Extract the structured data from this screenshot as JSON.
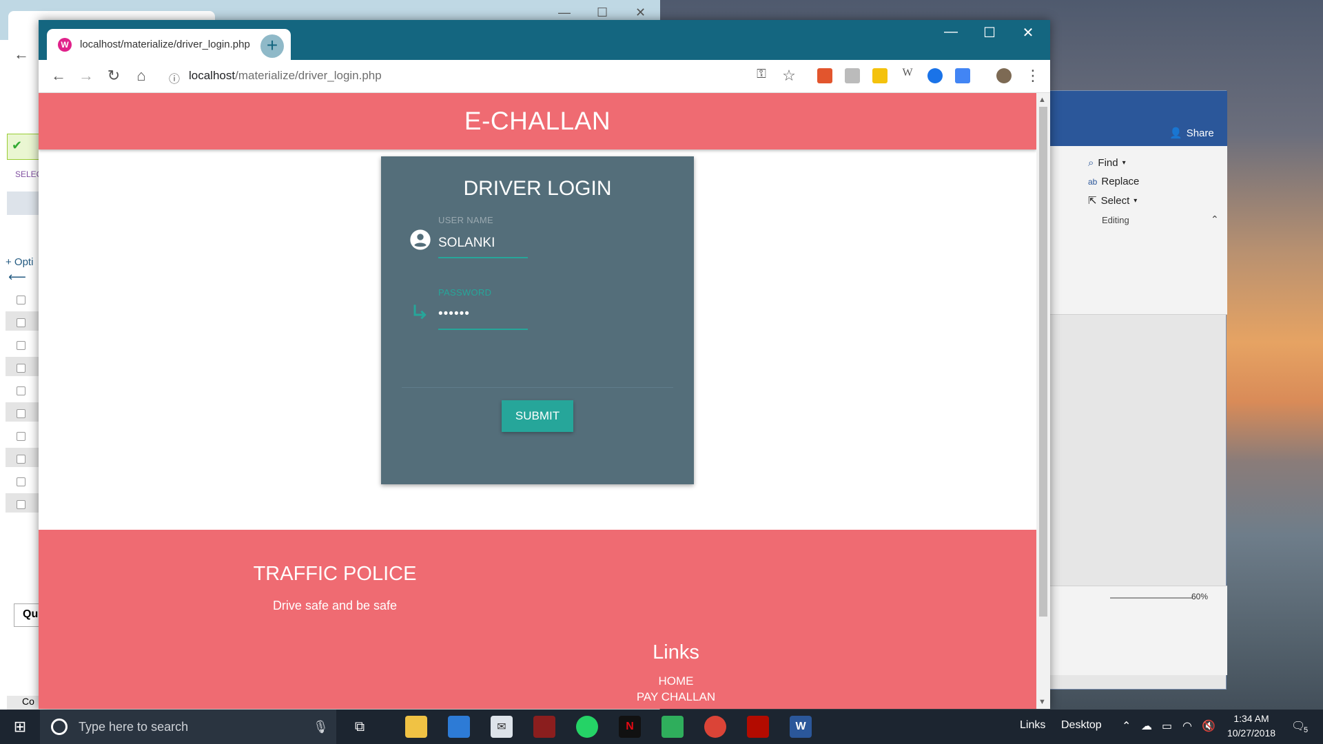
{
  "background_left_window": {
    "option_label": "+ Opti",
    "select_label": "SELEC",
    "query_label": "Qu",
    "console_label": "Co"
  },
  "background_word": {
    "share_label": "Share",
    "find_label": "Find",
    "replace_label": "Replace",
    "select_label": "Select",
    "group_label": "Editing",
    "zoom_label": "60%"
  },
  "browser": {
    "tab_title": "localhost/materialize/driver_login.php",
    "url_host": "localhost",
    "url_path": "/materialize/driver_login.php"
  },
  "page": {
    "header_title": "E-CHALLAN",
    "card_title": "DRIVER LOGIN",
    "username_label": "USER NAME",
    "username_value": "SOLANKI",
    "password_label": "PASSWORD",
    "password_value": "••••••",
    "submit_label": "SUBMIT",
    "footer_heading": "TRAFFIC POLICE",
    "footer_tagline": "Drive safe and be safe",
    "links_heading": "Links",
    "links": [
      "HOME",
      "PAY CHALLAN"
    ]
  },
  "taskbar": {
    "search_placeholder": "Type here to search",
    "links_label": "Links",
    "desktop_label": "Desktop",
    "time": "1:34 AM",
    "date": "10/27/2018",
    "notification_count": "5"
  },
  "colors": {
    "header_pink": "#ef6b72",
    "card_slate": "#546e7a",
    "accent_teal": "#26a69a",
    "chrome_titlebar": "#146680"
  }
}
